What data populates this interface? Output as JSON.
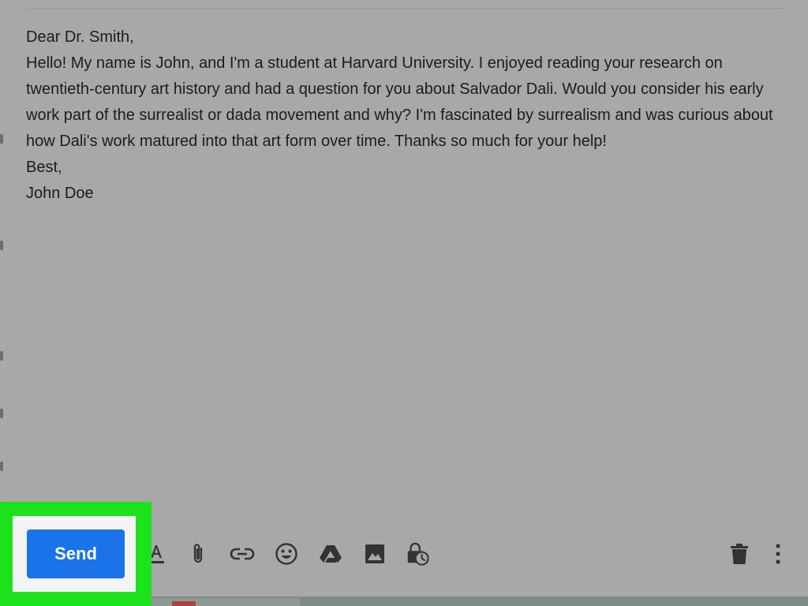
{
  "email": {
    "lines": [
      "Dear Dr. Smith,",
      "Hello! My name is John, and I'm a student at Harvard University. I enjoyed reading your research on twentieth-century art history and had a question for you about Salvador Dali. Would you consider his early work part of the surrealist or dada movement and why? I'm fascinated by surrealism and was curious about how Dali's work matured into that art form over time. Thanks so much for your help!",
      "Best,",
      "John Doe"
    ]
  },
  "toolbar": {
    "send_label": "Send",
    "icons": [
      "text-format-icon",
      "attachment-icon",
      "link-icon",
      "emoji-icon",
      "drive-icon",
      "photo-icon",
      "confidential-mode-icon",
      "trash-icon",
      "more-options-icon"
    ]
  },
  "colors": {
    "send_button": "#1a73e8",
    "highlight": "#1ce21c",
    "overlay": "#a8a8a8"
  }
}
